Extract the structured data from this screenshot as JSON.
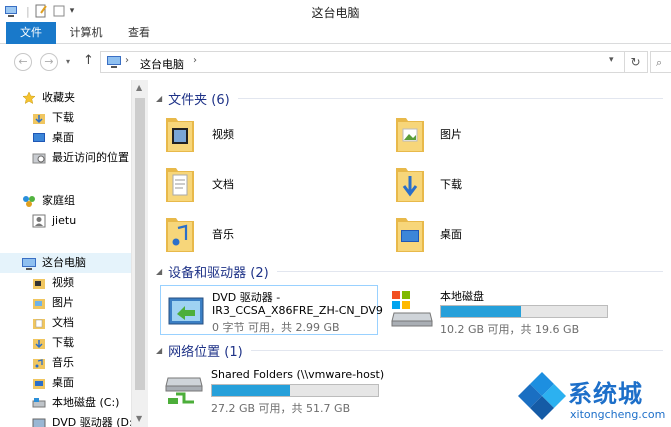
{
  "window": {
    "title": "这台电脑"
  },
  "ribbon": {
    "tabs": [
      "文件",
      "计算机",
      "查看"
    ]
  },
  "address": {
    "crumb": "这台电脑"
  },
  "nav": {
    "favorites": {
      "label": "收藏夹",
      "items": [
        "下载",
        "桌面",
        "最近访问的位置"
      ]
    },
    "homegroup": {
      "label": "家庭组",
      "items": [
        "jietu"
      ]
    },
    "thispc": {
      "label": "这台电脑",
      "items": [
        "视频",
        "图片",
        "文档",
        "下载",
        "音乐",
        "桌面",
        "本地磁盘 (C:)",
        "DVD 驱动器 (D:)"
      ]
    }
  },
  "folders": {
    "header": "文件夹 (6)",
    "items": [
      "视频",
      "图片",
      "文档",
      "下载",
      "音乐",
      "桌面"
    ]
  },
  "devices": {
    "header": "设备和驱动器 (2)",
    "dvd": {
      "name_line1": "DVD 驱动器 -",
      "name_line2": "IR3_CCSA_X86FRE_ZH-CN_DV9",
      "free": "0 字节 可用，共 2.99 GB"
    },
    "local": {
      "name": "本地磁盘",
      "free": "10.2 GB 可用，共 19.6 GB",
      "used_fraction": 0.48
    }
  },
  "network": {
    "header": "网络位置 (1)",
    "share": {
      "name": "Shared Folders (\\\\vmware-host)",
      "free": "27.2 GB 可用，共 51.7 GB",
      "used_fraction": 0.47
    }
  },
  "watermark": {
    "brand": "系统城",
    "url": "xitongcheng.com"
  },
  "colors": {
    "accent": "#1979ca",
    "bar": "#26a0da",
    "group_title": "#1e3287"
  }
}
